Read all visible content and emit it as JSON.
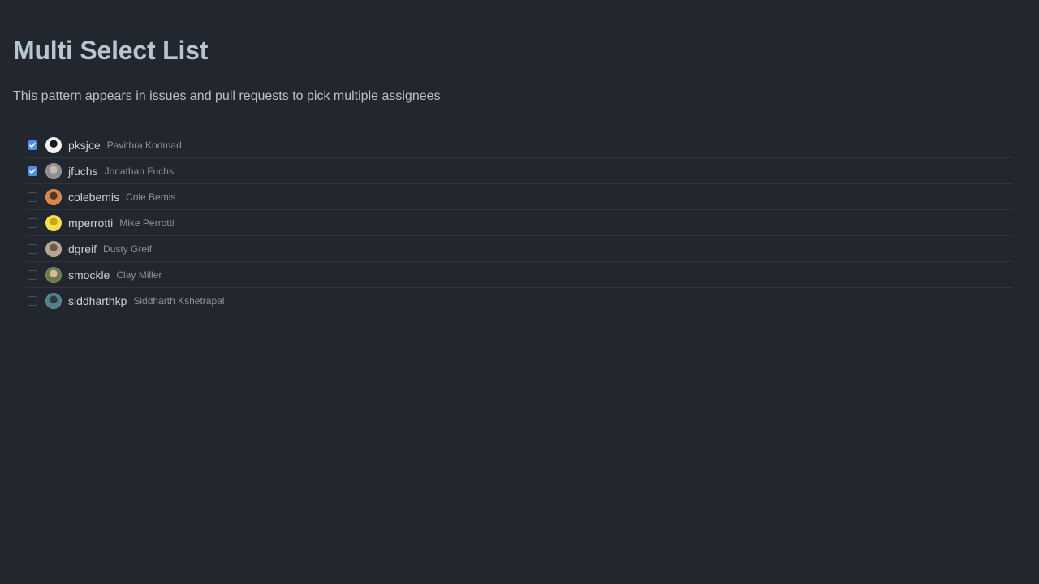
{
  "page": {
    "title": "Multi Select List",
    "description": "This pattern appears in issues and pull requests to pick multiple assignees"
  },
  "users": [
    {
      "login": "pksjce",
      "name": "Pavithra Kodmad",
      "checked": true,
      "avatar_colors": [
        "#f2f2f2",
        "#1a1a1a"
      ]
    },
    {
      "login": "jfuchs",
      "name": "Jonathan Fuchs",
      "checked": true,
      "avatar_colors": [
        "#8a8f96",
        "#c9b9a8"
      ]
    },
    {
      "login": "colebemis",
      "name": "Cole Bemis",
      "checked": false,
      "avatar_colors": [
        "#d7864a",
        "#5a3522"
      ]
    },
    {
      "login": "mperrotti",
      "name": "Mike Perrotti",
      "checked": false,
      "avatar_colors": [
        "#f4e04a",
        "#c9a514"
      ]
    },
    {
      "login": "dgreif",
      "name": "Dusty Greif",
      "checked": false,
      "avatar_colors": [
        "#b7a48e",
        "#6a5a4c"
      ]
    },
    {
      "login": "smockle",
      "name": "Clay Miller",
      "checked": false,
      "avatar_colors": [
        "#6b7a4d",
        "#d9b79a"
      ]
    },
    {
      "login": "siddharthkp",
      "name": "Siddharth Kshetrapal",
      "checked": false,
      "avatar_colors": [
        "#4d7f8c",
        "#2f3c3a"
      ]
    }
  ],
  "colors": {
    "background": "#22262e",
    "checkbox_checked": "#4f8fe8",
    "title": "#b8c4cf",
    "divider": "#30353d"
  }
}
